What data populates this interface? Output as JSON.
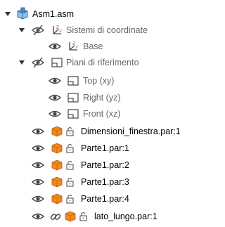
{
  "tree": {
    "root": {
      "label": "Asm1.asm",
      "icon": "assembly-icon"
    },
    "coord_systems": {
      "label": "Sistemi di coordinate",
      "icon": "coordinate-system-icon"
    },
    "base": {
      "label": "Base",
      "icon": "coordinate-system-icon"
    },
    "ref_planes": {
      "label": "Piani di riferimento",
      "icon": "plane-icon"
    },
    "top": {
      "label": "Top (xy)",
      "icon": "plane-icon"
    },
    "right": {
      "label": "Right (yz)",
      "icon": "plane-icon"
    },
    "front": {
      "label": "Front (xz)",
      "icon": "plane-icon"
    },
    "parts": [
      {
        "label": "Dimensioni_finestra.par:1",
        "icon": "part-icon",
        "lock": "lock-icon",
        "link": false
      },
      {
        "label": "Parte1.par:1",
        "icon": "part-icon",
        "lock": "lock-icon",
        "link": false
      },
      {
        "label": "Parte1.par:2",
        "icon": "part-icon",
        "lock": "lock-icon",
        "link": false
      },
      {
        "label": "Parte1.par:3",
        "icon": "part-icon",
        "lock": "lock-icon",
        "link": false
      },
      {
        "label": "Parte1.par:4",
        "icon": "part-icon",
        "lock": "lock-icon",
        "link": false
      },
      {
        "label": "lato_lungo.par:1",
        "icon": "part-icon",
        "lock": "lock-icon",
        "link": true
      }
    ]
  },
  "colors": {
    "part_orange": "#f08a1c",
    "part_dark": "#c8640a",
    "assembly_blue": "#3d8fd1",
    "coord_purple": "#7a4fa0",
    "coord_orange": "#e07a1a",
    "plane_gray": "#555555"
  }
}
